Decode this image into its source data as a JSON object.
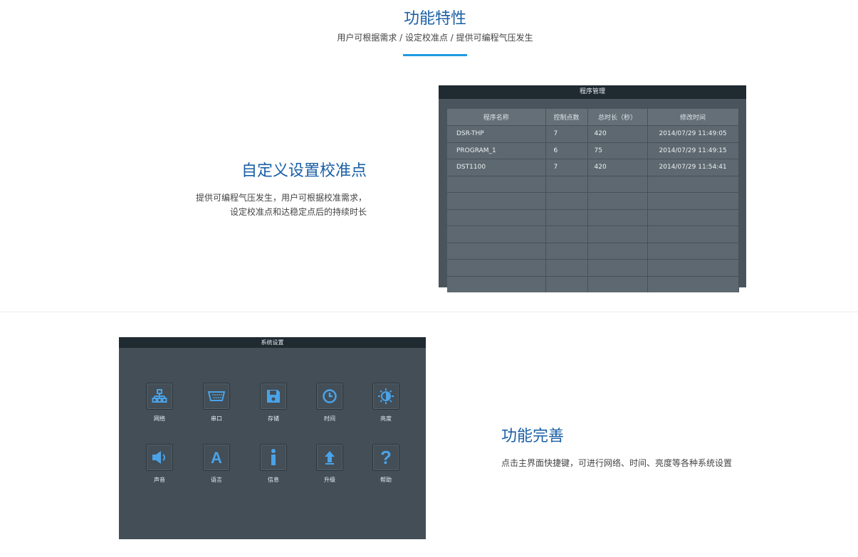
{
  "header": {
    "title": "功能特性",
    "subtitle": "用户可根据需求 / 设定校准点 / 提供可编程气压发生"
  },
  "feature1": {
    "title": "自定义设置校准点",
    "desc_line1": "提供可编程气压发生，用户可根据校准需求，",
    "desc_line2": "设定校准点和达稳定点后的持续时长"
  },
  "program_screen": {
    "title": "程序管理",
    "columns": [
      "程序名称",
      "控制点数",
      "总时长（秒）",
      "修改时间"
    ],
    "rows": [
      [
        "DSR-THP",
        "7",
        "420",
        "2014/07/29  11:49:05"
      ],
      [
        "PROGRAM_1",
        "6",
        "75",
        "2014/07/29  11:49:15"
      ],
      [
        "DST1100",
        "7",
        "420",
        "2014/07/29  11:54:41"
      ],
      [
        "",
        "",
        "",
        ""
      ],
      [
        "",
        "",
        "",
        ""
      ],
      [
        "",
        "",
        "",
        ""
      ],
      [
        "",
        "",
        "",
        ""
      ],
      [
        "",
        "",
        "",
        ""
      ],
      [
        "",
        "",
        "",
        ""
      ],
      [
        "",
        "",
        "",
        ""
      ]
    ]
  },
  "system_screen": {
    "title": "系统设置",
    "items": [
      {
        "label": "网络",
        "icon": "network-icon"
      },
      {
        "label": "串口",
        "icon": "serial-port-icon"
      },
      {
        "label": "存储",
        "icon": "storage-icon"
      },
      {
        "label": "时间",
        "icon": "clock-icon"
      },
      {
        "label": "亮度",
        "icon": "brightness-icon"
      },
      {
        "label": "声音",
        "icon": "speaker-icon"
      },
      {
        "label": "语言",
        "icon": "language-icon"
      },
      {
        "label": "信息",
        "icon": "info-icon"
      },
      {
        "label": "升级",
        "icon": "upgrade-icon"
      },
      {
        "label": "帮助",
        "icon": "help-icon"
      }
    ],
    "icon_color": "#4aa3e8"
  },
  "feature2": {
    "title": "功能完善",
    "desc": "点击主界面快捷键，可进行网络、时间、亮度等各种系统设置"
  }
}
